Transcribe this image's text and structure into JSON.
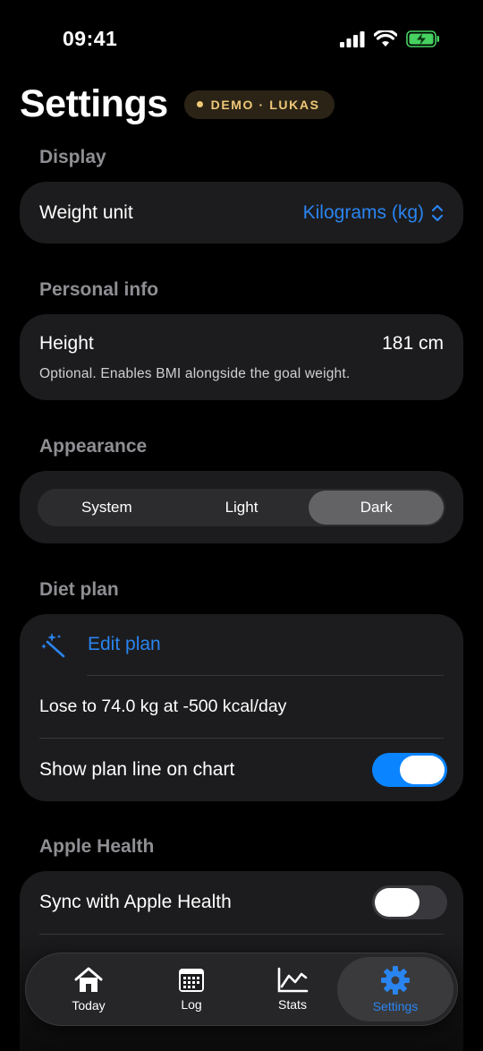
{
  "status": {
    "time": "09:41"
  },
  "header": {
    "title": "Settings",
    "badge": "DEMO · LUKAS"
  },
  "display": {
    "section": "Display",
    "weight_label": "Weight unit",
    "weight_value": "Kilograms (kg)"
  },
  "personal": {
    "section": "Personal info",
    "height_label": "Height",
    "height_value": "181 cm",
    "height_note": "Optional. Enables BMI alongside the goal weight."
  },
  "appearance": {
    "section": "Appearance",
    "options": [
      "System",
      "Light",
      "Dark"
    ],
    "selected": "Dark"
  },
  "diet": {
    "section": "Diet plan",
    "edit_label": "Edit plan",
    "summary": "Lose to 74.0 kg at -500 kcal/day",
    "plan_line_label": "Show plan line on chart",
    "plan_line_on": true
  },
  "health": {
    "section": "Apple Health",
    "sync_label": "Sync with Apple Health",
    "sync_on": false
  },
  "tabs": [
    {
      "label": "Today",
      "icon": "house-icon"
    },
    {
      "label": "Log",
      "icon": "calendar-icon"
    },
    {
      "label": "Stats",
      "icon": "chart-icon"
    },
    {
      "label": "Settings",
      "icon": "gear-icon",
      "active": true
    }
  ],
  "colors": {
    "accent": "#2a84f0",
    "badge": "#f0c878",
    "card": "#1c1c1e",
    "toggle_on": "#0a84ff"
  }
}
